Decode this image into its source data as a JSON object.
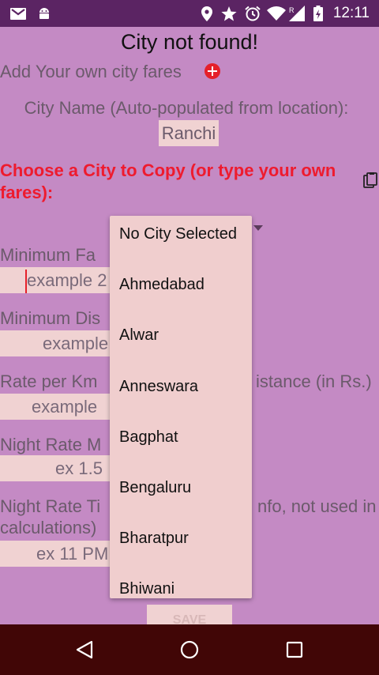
{
  "status_bar": {
    "time": "12:11",
    "icons": [
      "gmail-icon",
      "android-icon",
      "location-icon",
      "star-icon",
      "alarm-icon",
      "wifi-icon",
      "signal-icon",
      "battery-icon"
    ]
  },
  "page": {
    "title": "City not found!",
    "add_own": "Add Your own city fares",
    "city_name_label": "City Name (Auto-populated from location):",
    "city_name_value": "Ranchi",
    "copy_label": "Choose a City to Copy (or type your own fares):"
  },
  "fields": [
    {
      "label": "Minimum Fa",
      "placeholder": "example 2"
    },
    {
      "label": "Minimum Dis",
      "placeholder": "example"
    },
    {
      "label": "Rate per Km",
      "label_right": "istance (in Rs.)",
      "placeholder": "example"
    },
    {
      "label": "Night Rate M",
      "placeholder": "ex 1.5"
    },
    {
      "label": "Night Rate Ti",
      "label_right": "nfo, not used in",
      "label_line2": "calculations)",
      "placeholder": "ex 11 PM"
    }
  ],
  "save_label": "SAVE",
  "dropdown": {
    "options": [
      "No City Selected",
      "Ahmedabad",
      "Alwar",
      "Anneswara",
      "Bagphat",
      "Bengaluru",
      "Bharatpur",
      "Bhiwani"
    ]
  },
  "colors": {
    "background": "#c48ac4",
    "status_bar": "#5b2463",
    "accent_red": "#ee1b2e",
    "field_bg": "#f0d2d2",
    "nav_bar": "#410606"
  }
}
